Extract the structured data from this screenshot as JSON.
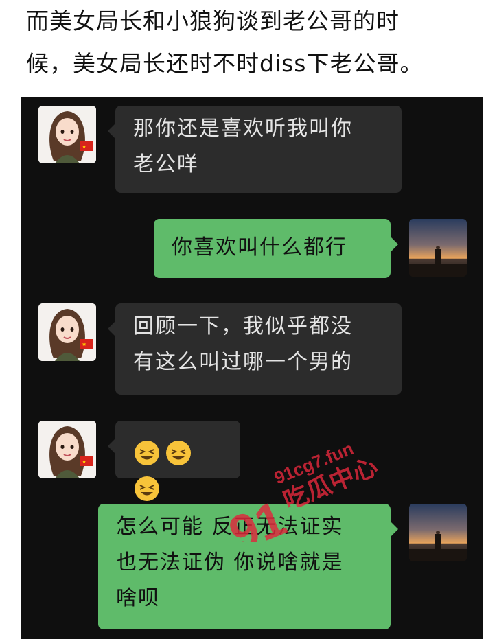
{
  "caption": {
    "line1": "而美女局长和小狼狗谈到老公哥的时",
    "line2": "候，美女局长还时不时diss下老公哥。"
  },
  "messages": [
    {
      "side": "in",
      "lines": [
        "那你还是喜欢听我叫你",
        "老公咩"
      ]
    },
    {
      "side": "out",
      "lines": [
        "你喜欢叫什么都行"
      ]
    },
    {
      "side": "in",
      "lines": [
        "回顾一下，我似乎都没",
        "有这么叫过哪一个男的"
      ]
    },
    {
      "side": "in",
      "emoji": [
        "grinning-squint-face",
        "grinning-squint-face",
        "grinning-squint-face"
      ]
    },
    {
      "side": "out",
      "lines": [
        "怎么可能 反正无法证实",
        "也无法证伪 你说啥就是",
        "啥呗"
      ]
    }
  ],
  "watermark": {
    "number": "91",
    "site": "91cg7.fun",
    "name": "吃瓜中心",
    "color": "#e0283c"
  },
  "colors": {
    "chat_bg": "#0f0f0f",
    "incoming_bubble": "#2c2c2c",
    "outgoing_bubble": "#5fbb6a"
  }
}
